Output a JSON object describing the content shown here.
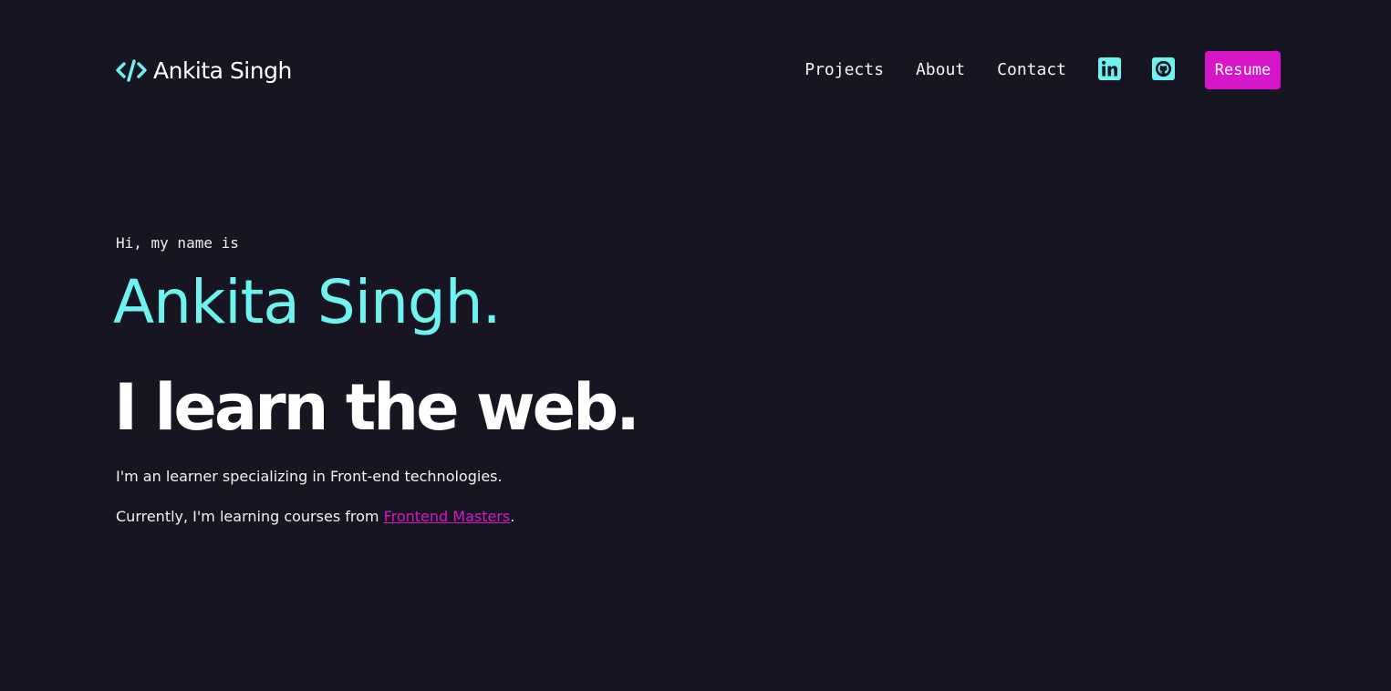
{
  "colors": {
    "background": "#181522",
    "accent_cyan": "#6ff3f0",
    "accent_magenta": "#d616c9",
    "text": "#f4f3f8"
  },
  "header": {
    "brand_icon": "code-icon",
    "brand_name": "Ankita Singh",
    "nav": {
      "projects": "Projects",
      "about": "About",
      "contact": "Contact"
    },
    "icons": {
      "linkedin": "linkedin-icon",
      "github": "github-icon"
    },
    "resume_label": "Resume"
  },
  "hero": {
    "greeting": "Hi, my name is",
    "name": "Ankita Singh.",
    "tagline": "I learn the web.",
    "bio": "I'm an learner specializing in Front-end technologies.",
    "learning_prefix": "Currently, I'm learning courses from ",
    "learning_link": "Frontend Masters",
    "learning_suffix": "."
  }
}
